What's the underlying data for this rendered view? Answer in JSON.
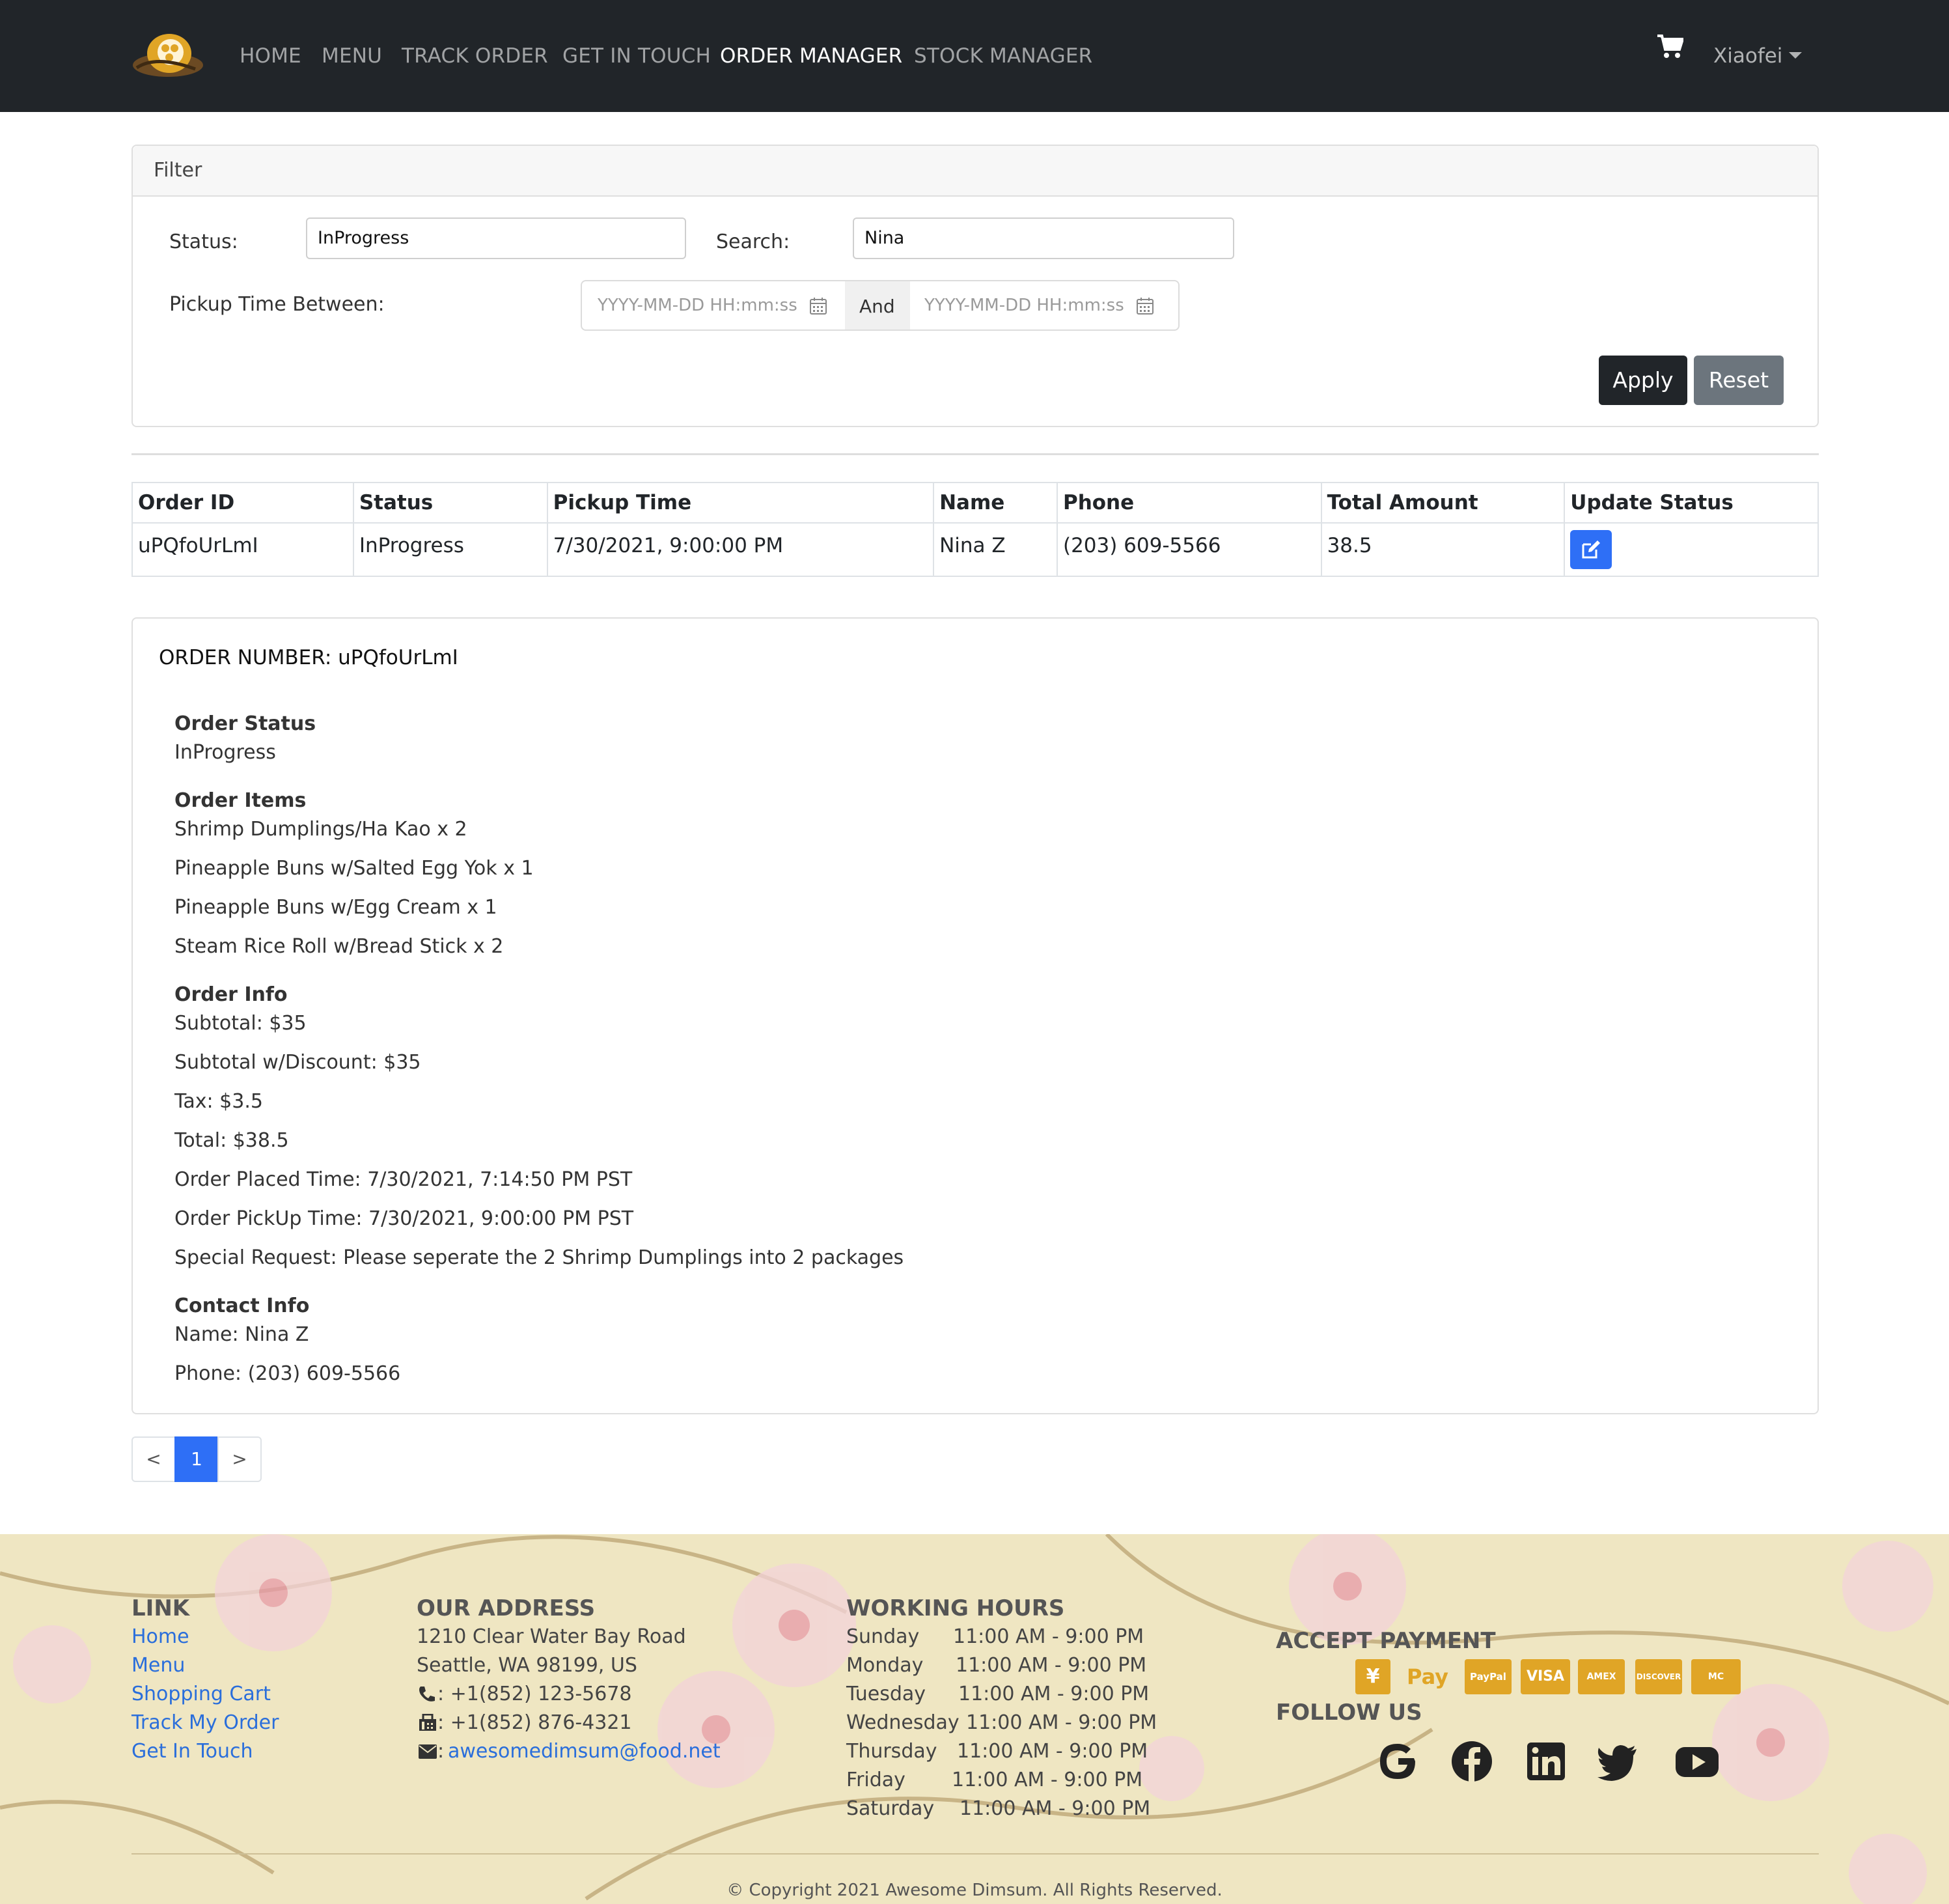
{
  "nav": {
    "items": [
      "HOME",
      "MENU",
      "TRACK ORDER",
      "GET IN TOUCH",
      "ORDER MANAGER",
      "STOCK MANAGER"
    ],
    "active": "ORDER MANAGER",
    "user": "Xiaofei"
  },
  "filter": {
    "title": "Filter",
    "status_label": "Status:",
    "status_value": "InProgress",
    "search_label": "Search:",
    "search_value": "Nina",
    "pickup_label": "Pickup Time Between:",
    "date_placeholder": "YYYY-MM-DD HH:mm:ss",
    "and_label": "And",
    "apply_label": "Apply",
    "reset_label": "Reset"
  },
  "table": {
    "headers": [
      "Order ID",
      "Status",
      "Pickup Time",
      "Name",
      "Phone",
      "Total Amount",
      "Update Status"
    ],
    "rows": [
      {
        "order_id": "uPQfoUrLmI",
        "status": "InProgress",
        "pickup_time": "7/30/2021, 9:00:00 PM",
        "name": "Nina Z",
        "phone": "(203) 609-5566",
        "total": "38.5"
      }
    ]
  },
  "detail": {
    "order_number": "ORDER NUMBER: uPQfoUrLmI",
    "status_heading": "Order Status",
    "status_value": "InProgress",
    "items_heading": "Order Items",
    "items": [
      "Shrimp Dumplings/Ha Kao x 2",
      "Pineapple Buns w/Salted Egg Yok x 1",
      "Pineapple Buns w/Egg Cream x 1",
      "Steam Rice Roll w/Bread Stick x 2"
    ],
    "info_heading": "Order Info",
    "info": [
      "Subtotal: $35",
      "Subtotal w/Discount: $35",
      "Tax: $3.5",
      "Total: $38.5",
      "Order Placed Time: 7/30/2021, 7:14:50 PM PST",
      "Order PickUp Time: 7/30/2021, 9:00:00 PM PST",
      "Special Request: Please seperate the 2 Shrimp Dumplings into 2 packages"
    ],
    "contact_heading": "Contact Info",
    "contact": [
      "Name: Nina Z",
      "Phone: (203) 609-5566"
    ]
  },
  "pagination": {
    "prev": "<",
    "current": "1",
    "next": ">"
  },
  "footer": {
    "link_heading": "LINK",
    "links": [
      "Home",
      "Menu",
      "Shopping Cart",
      "Track My Order",
      "Get In Touch"
    ],
    "address_heading": "OUR ADDRESS",
    "address": [
      "1210 Clear Water Bay Road",
      "Seattle, WA 98199, US"
    ],
    "phone": ": +1(852) 123-5678",
    "fax": ": +1(852) 876-4321",
    "email": "awesomedimsum@food.net",
    "hours_heading": "WORKING HOURS",
    "hours": [
      {
        "day": "Sunday",
        "time": "11:00 AM - 9:00 PM"
      },
      {
        "day": "Monday",
        "time": "11:00 AM - 9:00 PM"
      },
      {
        "day": "Tuesday",
        "time": "11:00 AM - 9:00 PM"
      },
      {
        "day": "Wednesday",
        "time": "11:00 AM - 9:00 PM"
      },
      {
        "day": "Thursday",
        "time": "11:00 AM - 9:00 PM"
      },
      {
        "day": "Friday",
        "time": "11:00 AM - 9:00 PM"
      },
      {
        "day": "Saturday",
        "time": "11:00 AM - 9:00 PM"
      }
    ],
    "payment_heading": "ACCEPT PAYMENT",
    "payments": [
      "alipay-icon",
      "apple-pay-icon",
      "paypal-icon",
      "visa-icon",
      "american-express-icon",
      "discover-icon",
      "mastercard-icon"
    ],
    "payment_labels": [
      "¥",
      " Pay",
      "PayPal",
      "VISA",
      "AMEX",
      "DISCOVER",
      "MC"
    ],
    "follow_heading": "FOLLOW US",
    "social": [
      "google-icon",
      "facebook-icon",
      "linkedin-icon",
      "twitter-icon",
      "youtube-icon"
    ],
    "copyright": "© Copyright 2021 Awesome Dimsum. All Rights Reserved."
  },
  "colors": {
    "navbar": "#212529",
    "primary": "#2e6ff6",
    "payment": "#e0a526",
    "footer_bg": "#efe6c2"
  }
}
